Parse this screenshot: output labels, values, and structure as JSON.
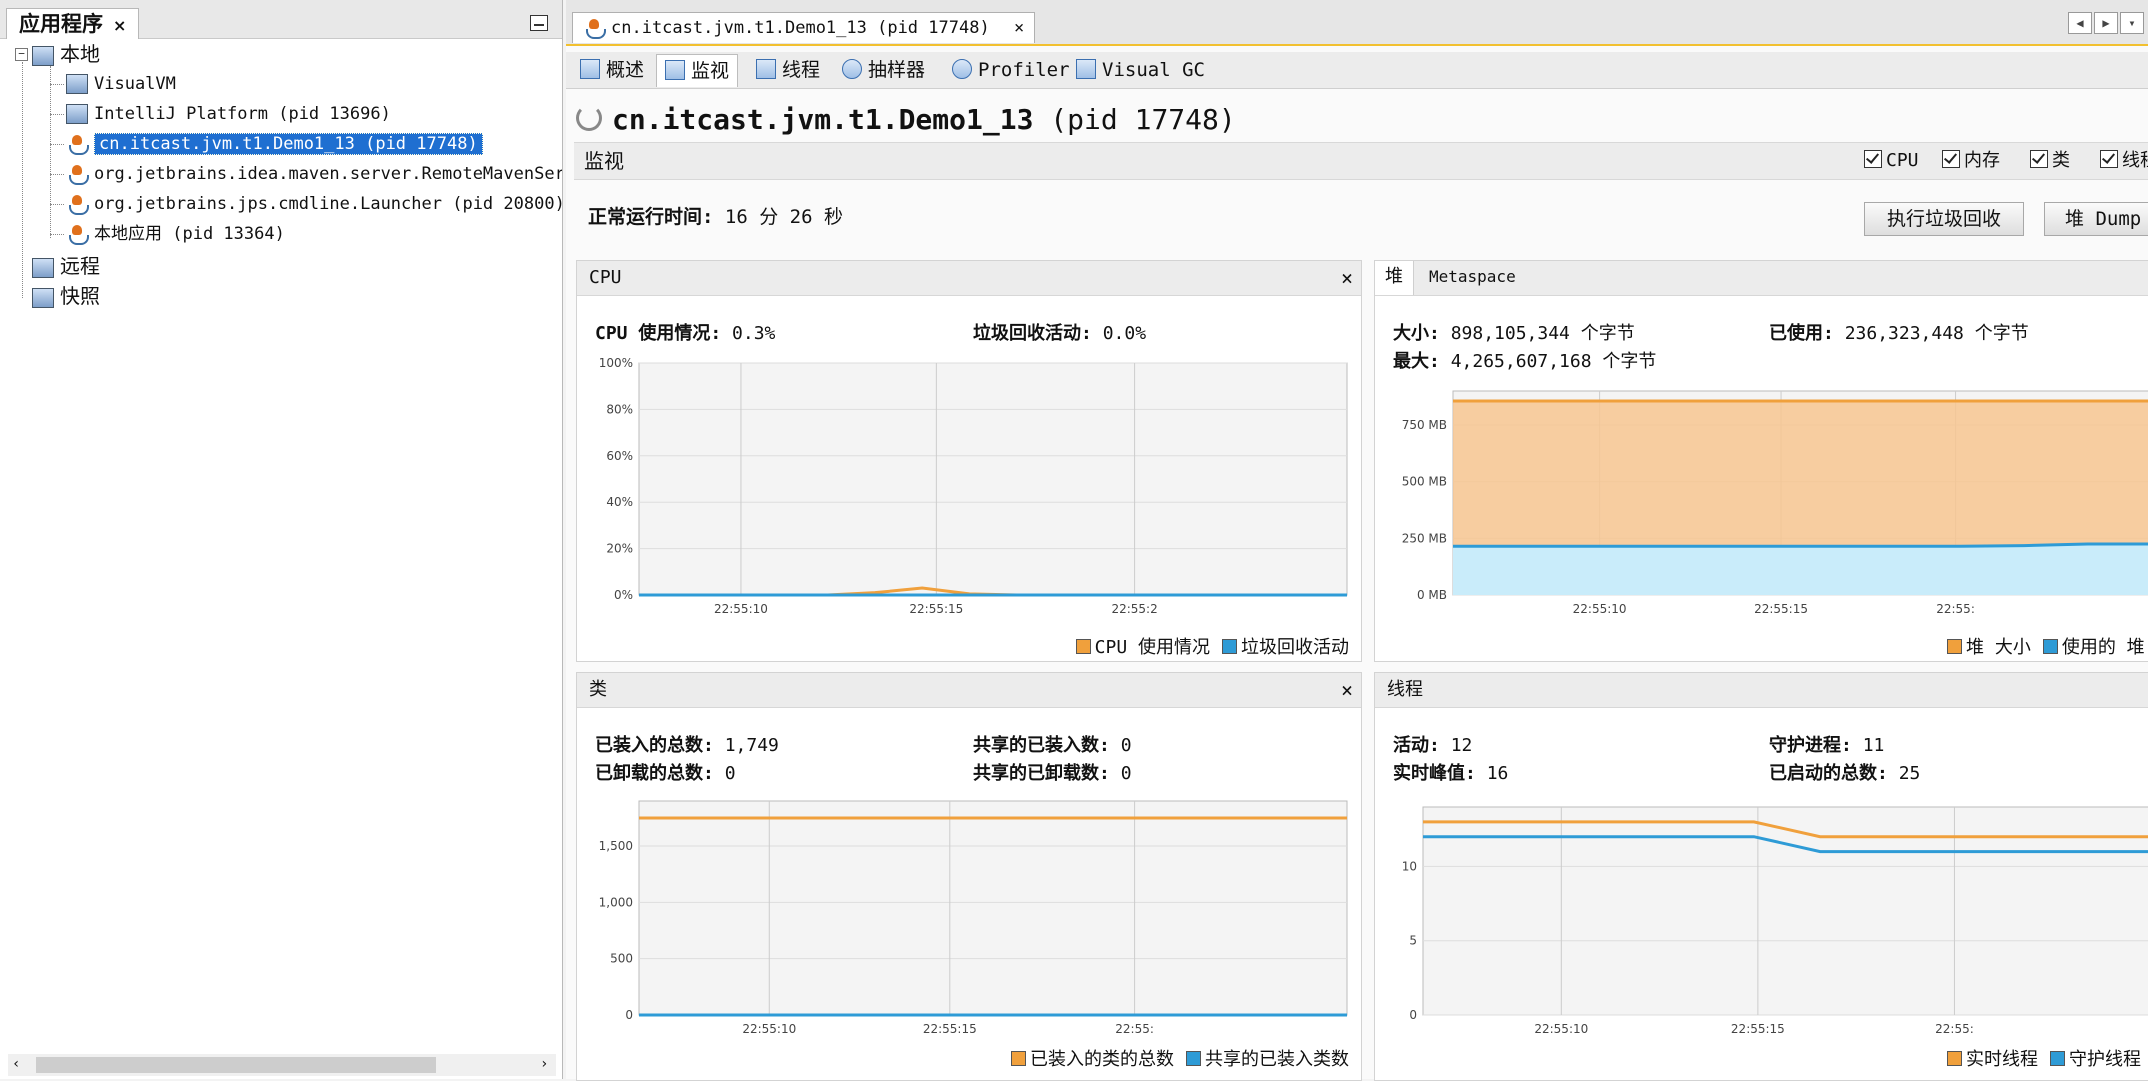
{
  "left_panel": {
    "title": "应用程序",
    "close": "×",
    "tree": [
      {
        "label": "本地",
        "level": 0,
        "icon": "computer-icon"
      },
      {
        "label": "VisualVM",
        "level": 1,
        "icon": "visualvm-icon"
      },
      {
        "label": "IntelliJ Platform (pid 13696)",
        "level": 1,
        "icon": "intellij-icon"
      },
      {
        "label": "cn.itcast.jvm.t1.Demo1_13 (pid 17748)",
        "level": 1,
        "icon": "java-icon",
        "selected": true
      },
      {
        "label": "org.jetbrains.idea.maven.server.RemoteMavenServe",
        "level": 1,
        "icon": "java-icon"
      },
      {
        "label": "org.jetbrains.jps.cmdline.Launcher (pid 20800)",
        "level": 1,
        "icon": "java-icon"
      },
      {
        "label": "本地应用 (pid 13364)",
        "level": 1,
        "icon": "java-icon"
      },
      {
        "label": "远程",
        "level": 0,
        "icon": "remote-icon"
      },
      {
        "label": "快照",
        "level": 0,
        "icon": "snapshot-icon"
      }
    ]
  },
  "doc_tab": {
    "label": "cn.itcast.jvm.t1.Demo1_13 (pid 17748)",
    "close": "×"
  },
  "subtabs": [
    "概述",
    "监视",
    "线程",
    "抽样器",
    "Profiler",
    "Visual GC"
  ],
  "active_subtab": "监视",
  "app_title": {
    "name": "cn.itcast.jvm.t1.Demo1_13",
    "pid": "(pid 17748)"
  },
  "monitor": {
    "label": "监视",
    "checkboxes": [
      "CPU",
      "内存",
      "类",
      "线程"
    ],
    "uptime_label": "正常运行时间:",
    "uptime_value": "16 分 26 秒",
    "gc_button": "执行垃圾回收",
    "dump_button": "堆 Dump"
  },
  "cpu_panel": {
    "title": "CPU",
    "close": "×",
    "usage_label": "CPU 使用情况:",
    "usage_value": "0.3%",
    "gc_label": "垃圾回收活动:",
    "gc_value": "0.0%",
    "legend": [
      "CPU 使用情况",
      "垃圾回收活动"
    ]
  },
  "heap_panel": {
    "tabs": [
      "堆",
      "Metaspace"
    ],
    "size_label": "大小:",
    "size_value": "898,105,344 个字节",
    "used_label": "已使用:",
    "used_value": "236,323,448 个字节",
    "max_label": "最大:",
    "max_value": "4,265,607,168 个字节",
    "legend": [
      "堆 大小",
      "使用的 堆"
    ]
  },
  "classes_panel": {
    "title": "类",
    "close": "×",
    "loaded_label": "已装入的总数:",
    "loaded_value": "1,749",
    "unloaded_label": "已卸载的总数:",
    "unloaded_value": "0",
    "shared_loaded_label": "共享的已装入数:",
    "shared_loaded_value": "0",
    "shared_unloaded_label": "共享的已卸载数:",
    "shared_unloaded_value": "0",
    "legend": [
      "已装入的类的总数",
      "共享的已装入类数"
    ]
  },
  "threads_panel": {
    "title": "线程",
    "live_label": "活动:",
    "live_value": "12",
    "daemon_label": "守护进程:",
    "daemon_value": "11",
    "peak_label": "实时峰值:",
    "peak_value": "16",
    "started_label": "已启动的总数:",
    "started_value": "25",
    "legend": [
      "实时线程",
      "守护线程"
    ]
  },
  "colors": {
    "orange": "#f0a03c",
    "blue": "#2e9bd6",
    "selection": "#1f6fd1",
    "tab_accent": "#f2c02f"
  },
  "chart_data": [
    {
      "type": "line",
      "name": "cpu",
      "x": [
        "22:55:06",
        "22:55:07",
        "22:55:08",
        "22:55:09",
        "22:55:10",
        "22:55:11",
        "22:55:12",
        "22:55:13",
        "22:55:14",
        "22:55:15",
        "22:55:16",
        "22:55:17",
        "22:55:18",
        "22:55:19",
        "22:55:20",
        "22:55:21"
      ],
      "xticks": [
        "22:55:10",
        "22:55:15",
        "22:55:2"
      ],
      "series": [
        {
          "name": "CPU 使用情况",
          "values": [
            0,
            0,
            0,
            0,
            0,
            1,
            3,
            0.5,
            0,
            0,
            0,
            0,
            0,
            0,
            0,
            0
          ]
        },
        {
          "name": "垃圾回收活动",
          "values": [
            0,
            0,
            0,
            0,
            0,
            0,
            0,
            0,
            0,
            0,
            0,
            0,
            0,
            0,
            0,
            0
          ]
        }
      ],
      "yticks": [
        "0%",
        "20%",
        "40%",
        "60%",
        "80%",
        "100%"
      ],
      "ylim": [
        0,
        100
      ]
    },
    {
      "type": "area",
      "name": "heap",
      "xticks": [
        "22:55:10",
        "22:55:15",
        "22:55:"
      ],
      "series": [
        {
          "name": "堆 大小",
          "values": [
            856,
            856,
            856,
            856,
            856,
            856,
            856,
            856,
            856,
            856,
            856,
            856
          ]
        },
        {
          "name": "使用的 堆",
          "values": [
            215,
            215,
            215,
            215,
            215,
            215,
            215,
            215,
            215,
            218,
            225,
            225
          ]
        }
      ],
      "yticks": [
        "0 MB",
        "250 MB",
        "500 MB",
        "750 MB"
      ],
      "ylim": [
        0,
        900
      ]
    },
    {
      "type": "line",
      "name": "classes",
      "xticks": [
        "22:55:10",
        "22:55:15",
        "22:55:"
      ],
      "series": [
        {
          "name": "已装入的类的总数",
          "values": [
            1749,
            1749,
            1749,
            1749,
            1749,
            1749,
            1749,
            1749,
            1749,
            1749,
            1749,
            1749
          ]
        },
        {
          "name": "共享的已装入类数",
          "values": [
            0,
            0,
            0,
            0,
            0,
            0,
            0,
            0,
            0,
            0,
            0,
            0
          ]
        }
      ],
      "yticks": [
        "0",
        "500",
        "1,000",
        "1,500"
      ],
      "ylim": [
        0,
        1900
      ]
    },
    {
      "type": "line",
      "name": "threads",
      "xticks": [
        "22:55:10",
        "22:55:15",
        "22:55:"
      ],
      "series": [
        {
          "name": "实时线程",
          "values": [
            13,
            13,
            13,
            13,
            13,
            13,
            12,
            12,
            12,
            12,
            12,
            12
          ]
        },
        {
          "name": "守护线程",
          "values": [
            12,
            12,
            12,
            12,
            12,
            12,
            11,
            11,
            11,
            11,
            11,
            11
          ]
        }
      ],
      "yticks": [
        "0",
        "5",
        "10"
      ],
      "ylim": [
        0,
        14
      ]
    }
  ]
}
